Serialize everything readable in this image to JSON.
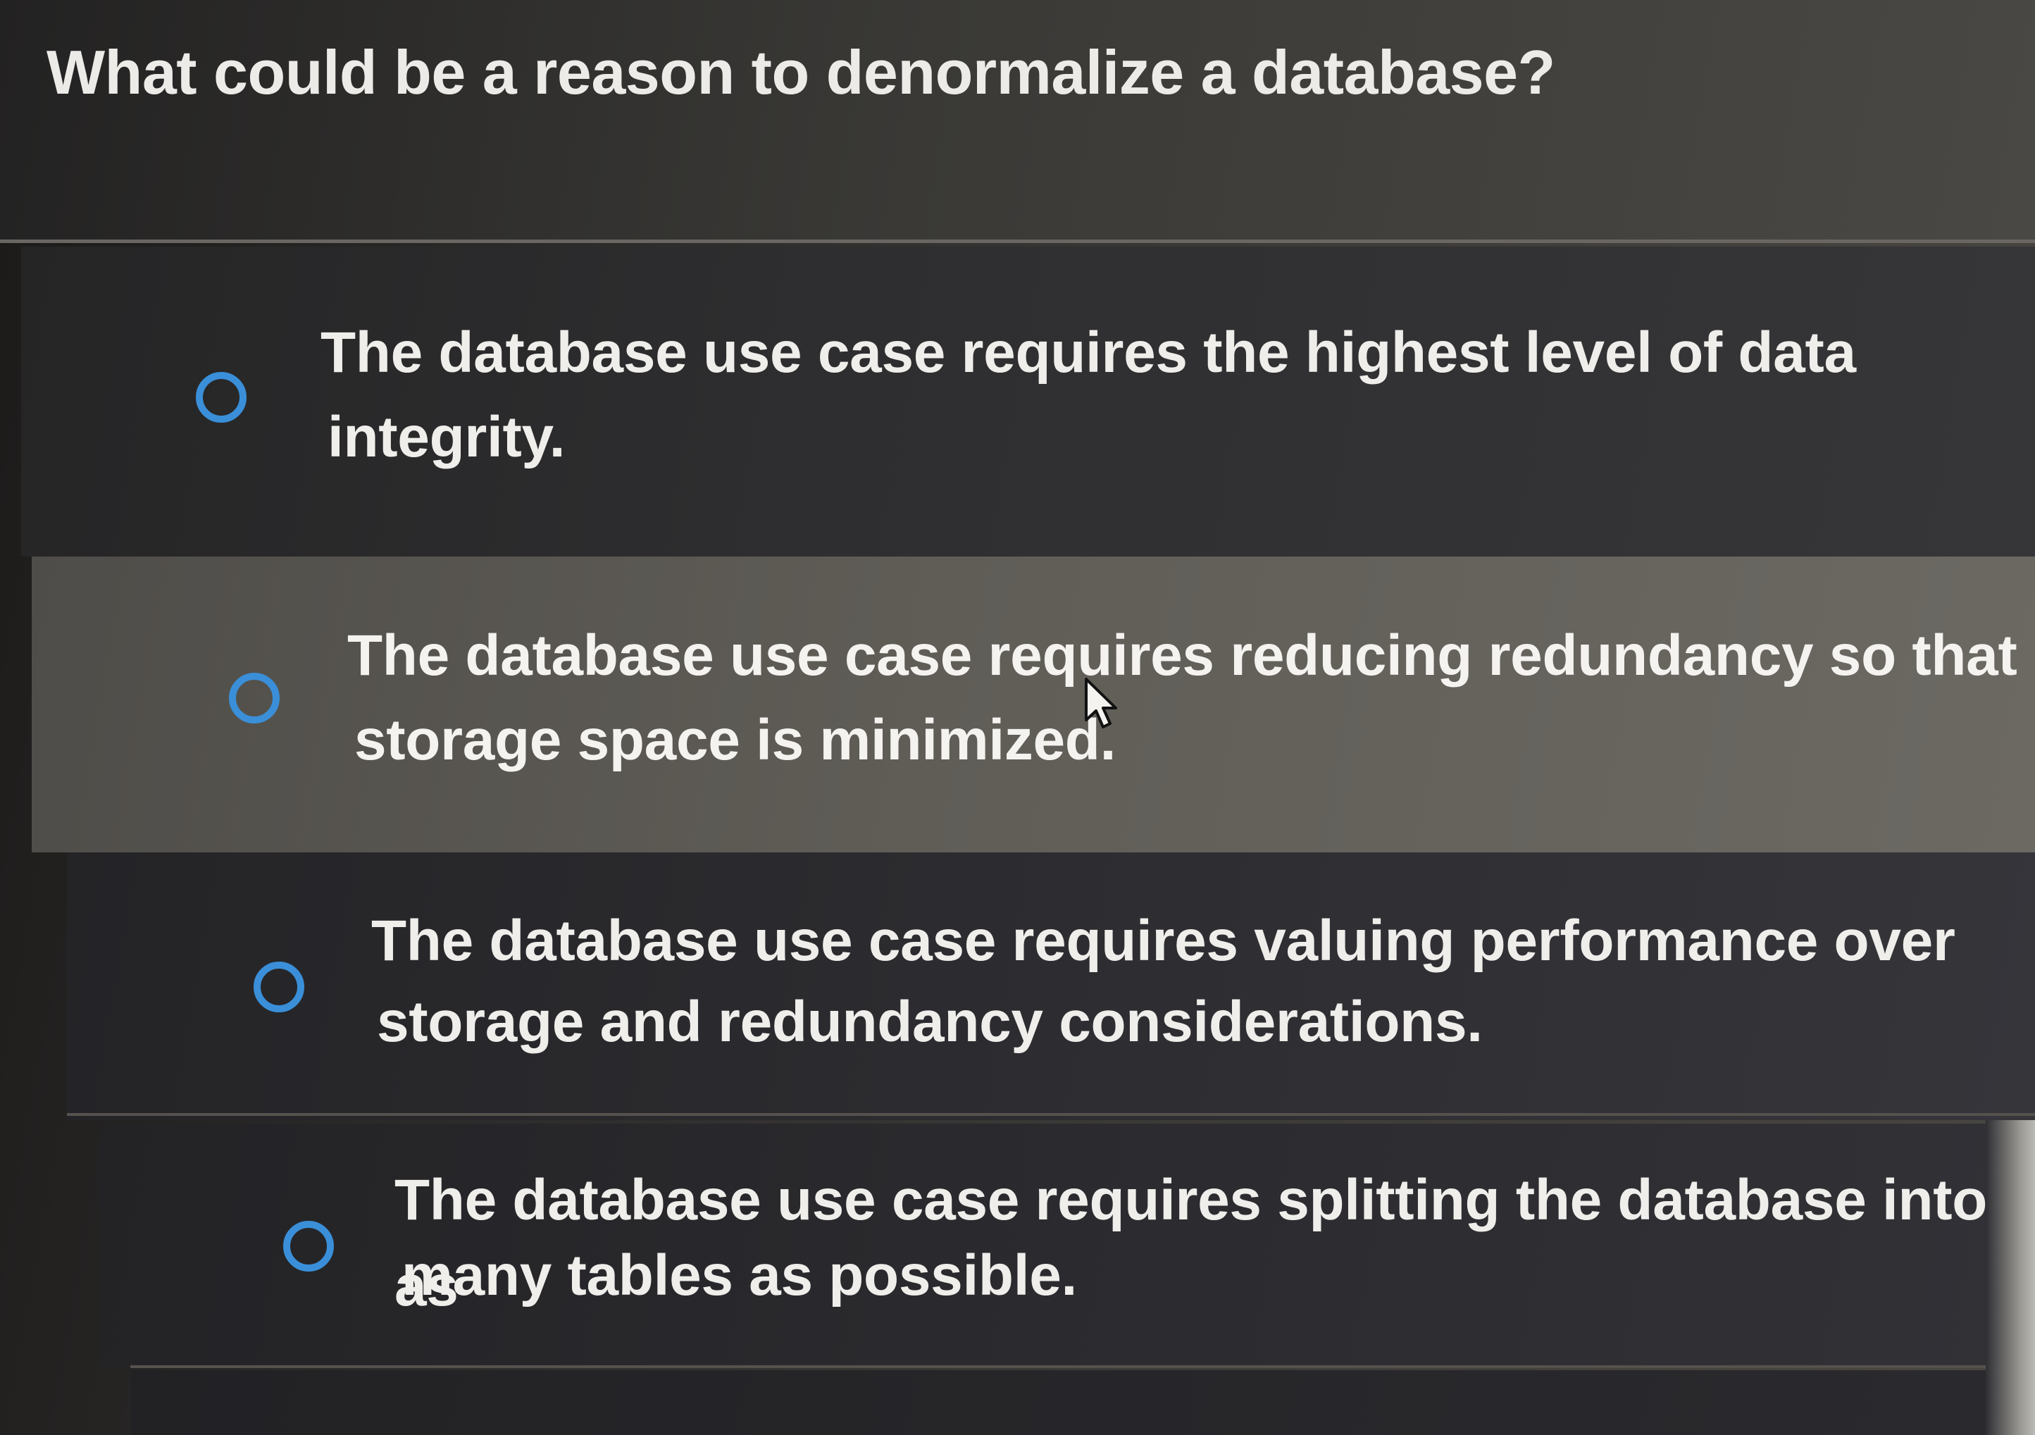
{
  "question": {
    "text": "What could be a reason to denormalize a database?"
  },
  "options": [
    {
      "line1": "The database use case requires the highest level of data",
      "line2": "integrity.",
      "selected": false
    },
    {
      "line1": "The database use case requires reducing redundancy so that",
      "line2": "storage space is minimized.",
      "selected": false
    },
    {
      "line1": "The database use case requires valuing performance over",
      "line2": "storage and redundancy considerations.",
      "selected": false
    },
    {
      "line1": "The database use case requires splitting the database into as",
      "line2": "many tables as possible.",
      "selected": false
    }
  ],
  "colors": {
    "radio_accent": "#3a8fd8",
    "text": "#efeeeb",
    "hover_row": "#605d57"
  },
  "icons": {
    "radio": "radio-unchecked-icon",
    "cursor": "mouse-pointer-icon"
  }
}
